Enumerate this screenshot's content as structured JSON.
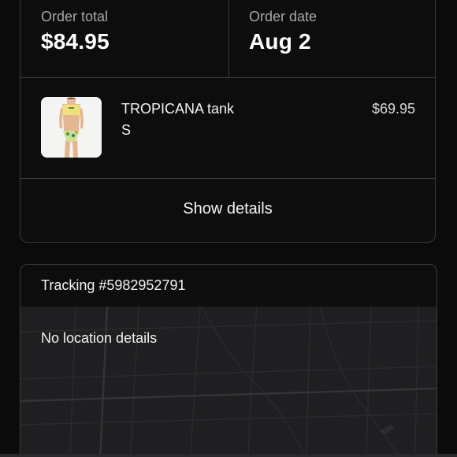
{
  "order": {
    "total_label": "Order total",
    "total_value": "$84.95",
    "date_label": "Order date",
    "date_value": "Aug 2"
  },
  "item": {
    "name": "TROPICANA tank",
    "size": "S",
    "price": "$69.95",
    "thumbnail_icon": "product-photo"
  },
  "details_button": {
    "label": "Show details"
  },
  "tracking": {
    "title": "Tracking #5982952791",
    "map_message": "No location details"
  },
  "colors": {
    "background": "#0b0b0c",
    "card_border": "#3a3a3c",
    "map_background": "#1f1f21",
    "muted_text": "#a7a7aa"
  }
}
